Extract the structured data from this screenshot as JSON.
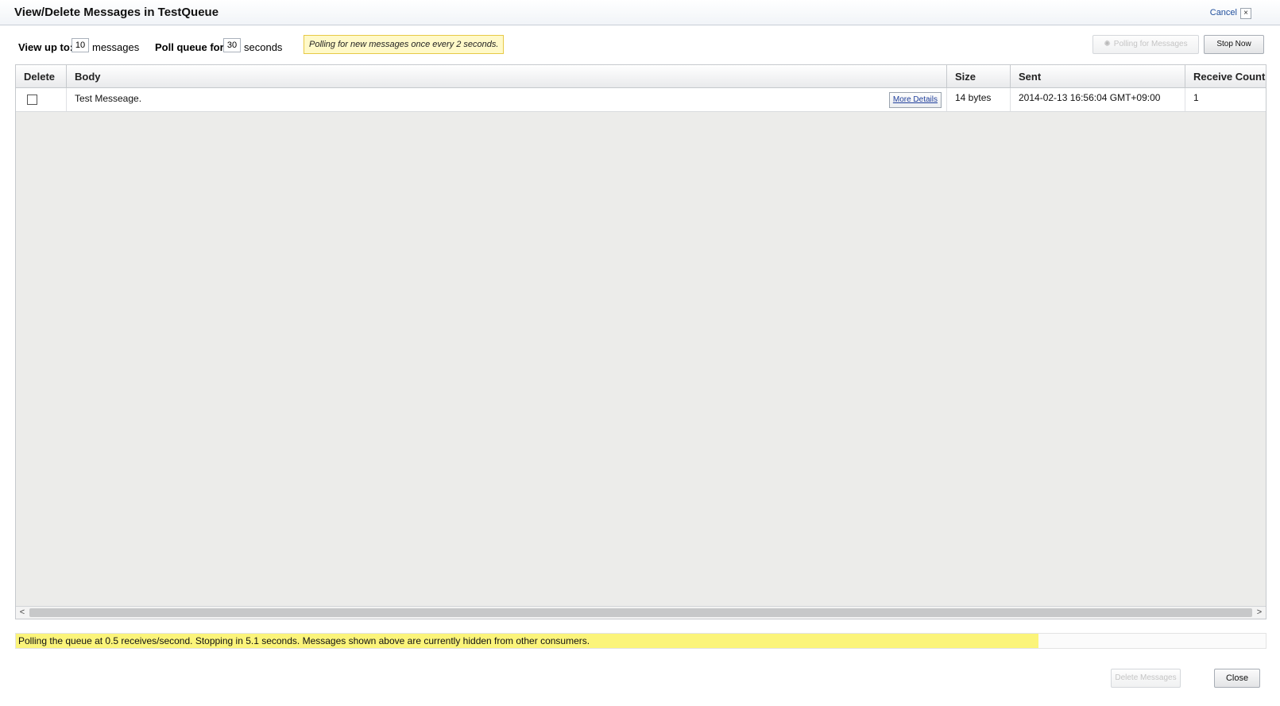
{
  "dialog": {
    "title": "View/Delete Messages in TestQueue",
    "cancel_label": "Cancel",
    "close_glyph": "×"
  },
  "toolbar": {
    "view_up_to_label": "View up to:",
    "view_up_to_value": "10",
    "messages_label": "messages",
    "poll_for_label": "Poll queue for:",
    "poll_for_value": "30",
    "seconds_label": "seconds",
    "poll_notice": "Polling for new messages once every 2 seconds.",
    "polling_button_label": "Polling for Messages",
    "stop_button_label": "Stop Now"
  },
  "table": {
    "columns": [
      "Delete",
      "Body",
      "Size",
      "Sent",
      "Receive Count"
    ],
    "rows": [
      {
        "body": "Test Messeage.",
        "more_details_label": "More Details",
        "size": "14 bytes",
        "sent": "2014-02-13 16:56:04 GMT+09:00",
        "receive_count": "1"
      }
    ]
  },
  "scrollbar": {
    "left_arrow": "<",
    "right_arrow": ">"
  },
  "status": {
    "text": "Polling the queue at 0.5 receives/second. Stopping in 5.1 seconds. Messages shown above are currently hidden from other consumers.",
    "progress_percent": 81.8
  },
  "footer": {
    "delete_button_label": "Delete Messages",
    "close_button_label": "Close"
  },
  "colors": {
    "status_fill": "#fbf47a",
    "notice_bg": "#fff9c8",
    "link": "#1f4e9c"
  },
  "icons": [
    "close-icon",
    "spinner-icon",
    "chevron-left-icon",
    "chevron-right-icon"
  ]
}
